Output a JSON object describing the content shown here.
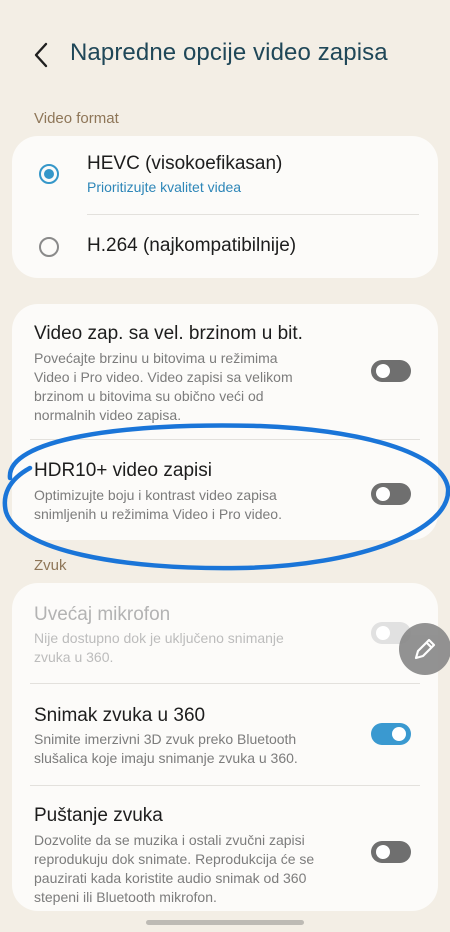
{
  "header": {
    "title": "Napredne opcije video zapisa",
    "back_icon": "chevron-left-icon"
  },
  "video_format": {
    "label": "Video format",
    "options": [
      {
        "title": "HEVC (visokoefikasan)",
        "subtitle": "Prioritizujte kvalitet videa",
        "selected": true
      },
      {
        "title": "H.264 (najkompatibilnije)",
        "selected": false
      }
    ]
  },
  "video_settings": [
    {
      "title": "Video zap. sa vel. brzinom u bit.",
      "description": "Povećajte brzinu u bitovima u režimima\nVideo i Pro video. Video zapisi sa velikom\nbrzinom u bitovima su obično veći od\nnormalnih video zapisa.",
      "enabled": false
    },
    {
      "title": "HDR10+ video zapisi",
      "description": "Optimizujte boju i kontrast video zapisa\nsnimljenih u režimima Video i Pro video.",
      "enabled": false
    }
  ],
  "sound": {
    "label": "Zvuk",
    "items": [
      {
        "title": "Uvećaj mikrofon",
        "description": "Nije dostupno dok je uključeno snimanje\nzvuka u 360.",
        "enabled": false,
        "disabled": true
      },
      {
        "title": "Snimak zvuka u 360",
        "description": "Snimite imerzivni 3D zvuk preko Bluetooth\nslušalica koje imaju snimanje zvuka u 360.",
        "enabled": true
      },
      {
        "title": "Puštanje zvuka",
        "description": "Dozvolite da se muzika i ostali zvučni zapisi\nreprodukuju dok snimate. Reprodukcija će se\npauzirati kada koristite audio snimak od 360\nstepeni ili Bluetooth mikrofon.",
        "enabled": false
      }
    ]
  },
  "edit_button": {
    "icon": "pencil-icon"
  },
  "colors": {
    "accent": "#3597c9",
    "title": "#1f4758",
    "section_label": "#8e7658",
    "annotation": "#1a75d8"
  }
}
